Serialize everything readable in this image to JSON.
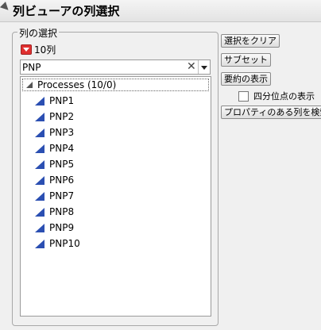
{
  "title": "列ビューアの列選択",
  "column_select": {
    "legend": "列の選択",
    "count_label": "10列",
    "search": {
      "value": "PNP",
      "clear_glyph": "✕"
    },
    "group": {
      "label": "Processes (10/0)"
    },
    "items": [
      "PNP1",
      "PNP2",
      "PNP3",
      "PNP4",
      "PNP5",
      "PNP6",
      "PNP7",
      "PNP8",
      "PNP9",
      "PNP10"
    ]
  },
  "buttons": {
    "clear_selection": "選択をクリア",
    "subset": "サブセット",
    "show_summary": "要約の表示",
    "find_columns_with_properties": "プロパティのある列を検索"
  },
  "checkbox": {
    "quartiles_label": "四分位点の表示",
    "checked": false
  },
  "colors": {
    "column_icon": "#2b4fb2",
    "menu_red": "#e03030"
  }
}
